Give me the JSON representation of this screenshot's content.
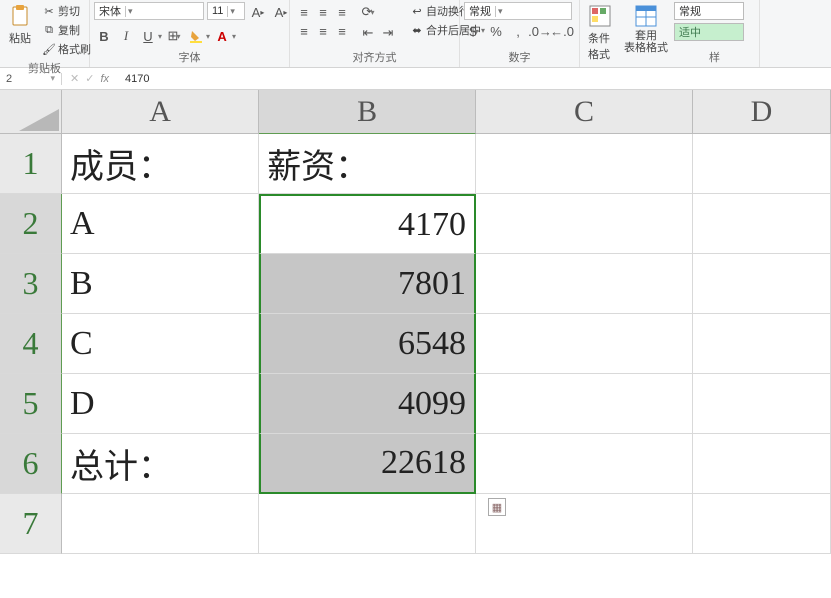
{
  "ribbon": {
    "clipboard": {
      "label": "剪贴板",
      "paste": "粘贴",
      "cut": "剪切",
      "copy": "复制",
      "format_painter": "格式刷"
    },
    "font": {
      "label": "字体",
      "family": "宋体",
      "size": "11",
      "bold": "B",
      "italic": "I",
      "underline": "U"
    },
    "align": {
      "label": "对齐方式",
      "wrap": "自动换行",
      "merge": "合并后居中"
    },
    "number": {
      "label": "数字",
      "format": "常规"
    },
    "styles": {
      "label": "样",
      "cond_format": "条件格式",
      "table_format": "套用\n表格格式",
      "normal": "常规",
      "good": "适中"
    }
  },
  "formula_bar": {
    "cell_ref": "2",
    "fx": "fx",
    "value": "4170"
  },
  "columns": [
    "A",
    "B",
    "C",
    "D"
  ],
  "rows": [
    "1",
    "2",
    "3",
    "4",
    "5",
    "6",
    "7"
  ],
  "data": {
    "A1": "成员：",
    "B1": "薪资：",
    "A2": "A",
    "B2": "4170",
    "A3": "B",
    "B3": "7801",
    "A4": "C",
    "B4": "6548",
    "A5": "D",
    "B5": "4099",
    "A6": "总计：",
    "B6": "22618"
  },
  "col_widths": {
    "A": 200,
    "B": 220,
    "C": 220,
    "D": 140
  },
  "selection": {
    "range": "B2:B6",
    "active": "B2"
  },
  "chart_data": {
    "type": "table",
    "title": "",
    "columns": [
      "成员：",
      "薪资："
    ],
    "rows": [
      [
        "A",
        4170
      ],
      [
        "B",
        7801
      ],
      [
        "C",
        6548
      ],
      [
        "D",
        4099
      ],
      [
        "总计：",
        22618
      ]
    ]
  }
}
